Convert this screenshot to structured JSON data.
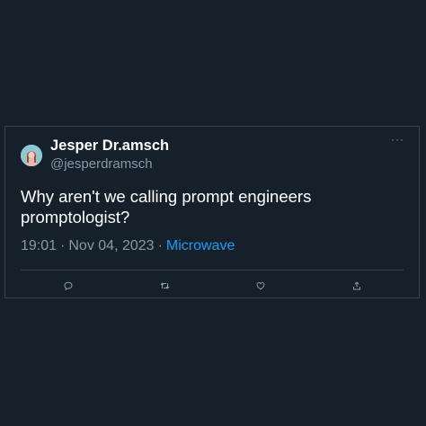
{
  "tweet": {
    "display_name": "Jesper Dr.amsch",
    "handle": "@jesperdramsch",
    "text": "Why aren't we calling prompt engineers promptologist?",
    "time": "19:01",
    "date": "Nov 04, 2023",
    "source": "Microwave",
    "separator": "·",
    "more": "···"
  },
  "actions": [
    {
      "name": "reply",
      "icon": "reply-icon"
    },
    {
      "name": "retweet",
      "icon": "retweet-icon"
    },
    {
      "name": "like",
      "icon": "heart-icon"
    },
    {
      "name": "share",
      "icon": "share-icon"
    }
  ],
  "colors": {
    "background": "#15202b",
    "border": "#38444d",
    "text": "#ffffff",
    "muted": "#8b98a5",
    "link": "#1d9bf0"
  }
}
